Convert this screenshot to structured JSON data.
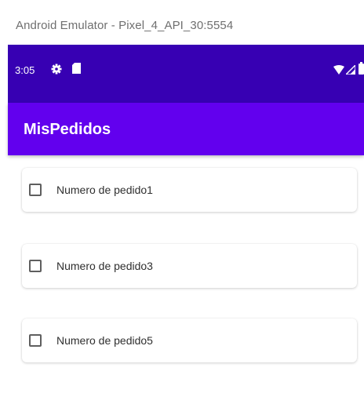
{
  "window": {
    "title": "Android Emulator - Pixel_4_API_30:5554"
  },
  "status_bar": {
    "time": "3:05",
    "icons": [
      "gear-icon",
      "sd-card-icon",
      "wifi-icon",
      "signal-icon",
      "battery-icon"
    ],
    "color": "#3700b3"
  },
  "app_bar": {
    "title": "MisPedidos",
    "color": "#6200ee"
  },
  "orders": [
    {
      "label": "Numero de pedido1",
      "checked": false
    },
    {
      "label": "Numero de pedido3",
      "checked": false
    },
    {
      "label": "Numero de pedido5",
      "checked": false
    }
  ]
}
